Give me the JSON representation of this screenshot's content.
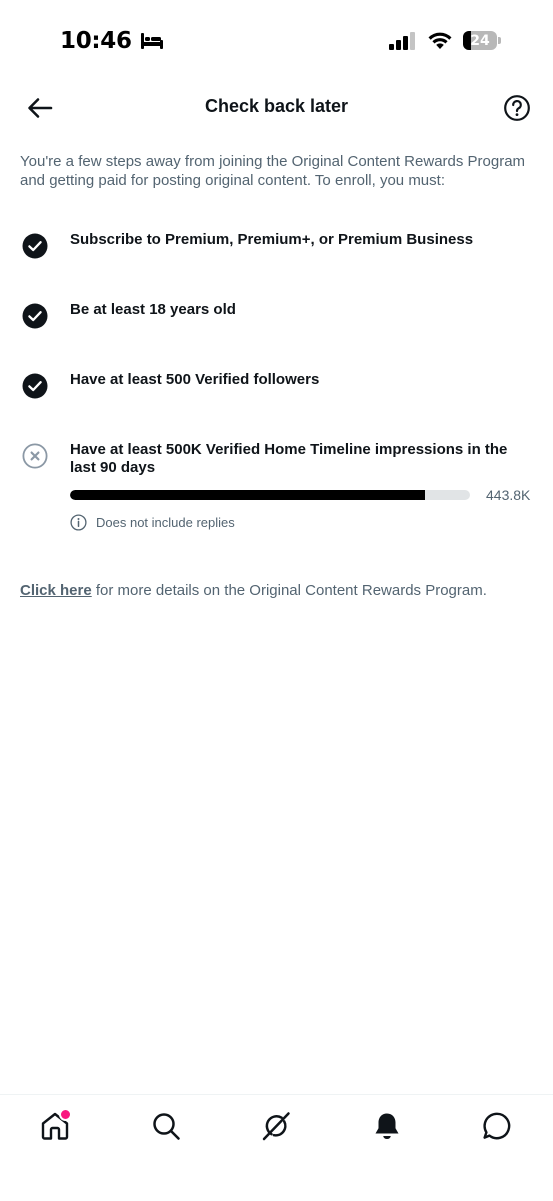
{
  "status_bar": {
    "time": "10:46",
    "battery_percent": "24",
    "battery_level": 0.24,
    "icons": [
      "bed-icon",
      "signal-icon",
      "wifi-icon",
      "battery-icon"
    ]
  },
  "header": {
    "title": "Check back later",
    "back_icon": "arrow-left-icon",
    "help_icon": "question-circle-icon"
  },
  "intro_text": "You're a few steps away from joining the Original Content Rewards Program and getting paid for posting original content. To enroll, you must:",
  "requirements": [
    {
      "label": "Subscribe to Premium, Premium+, or Premium Business",
      "status": "complete",
      "icon": "check-circle-icon"
    },
    {
      "label": "Be at least 18 years old",
      "status": "complete",
      "icon": "check-circle-icon"
    },
    {
      "label": "Have at least 500 Verified followers",
      "status": "complete",
      "icon": "check-circle-icon"
    },
    {
      "label": "Have at least 500K Verified Home Timeline impressions in the last 90 days",
      "status": "incomplete",
      "icon": "x-circle-icon",
      "progress": {
        "current": 443.8,
        "target": 500,
        "unit": "K",
        "display_value": "443.8K"
      },
      "note": "Does not include replies"
    }
  ],
  "footer": {
    "link_text": "Click here",
    "rest_text": " for more details on the Original Content Rewards Program."
  },
  "tab_bar": {
    "tabs": [
      {
        "name": "home",
        "icon": "home-icon",
        "has_notification_dot": true
      },
      {
        "name": "search",
        "icon": "search-icon",
        "has_notification_dot": false
      },
      {
        "name": "grok",
        "icon": "grok-icon",
        "has_notification_dot": false
      },
      {
        "name": "notifications",
        "icon": "bell-icon",
        "has_notification_dot": false
      },
      {
        "name": "messages",
        "icon": "message-icon",
        "has_notification_dot": false
      }
    ]
  },
  "colors": {
    "text_primary": "#0f1419",
    "text_secondary": "#536471",
    "progress_fill": "#000000",
    "progress_track": "#e1e4e6",
    "notification_dot": "#f91880",
    "incomplete_icon": "#8b98a5"
  }
}
